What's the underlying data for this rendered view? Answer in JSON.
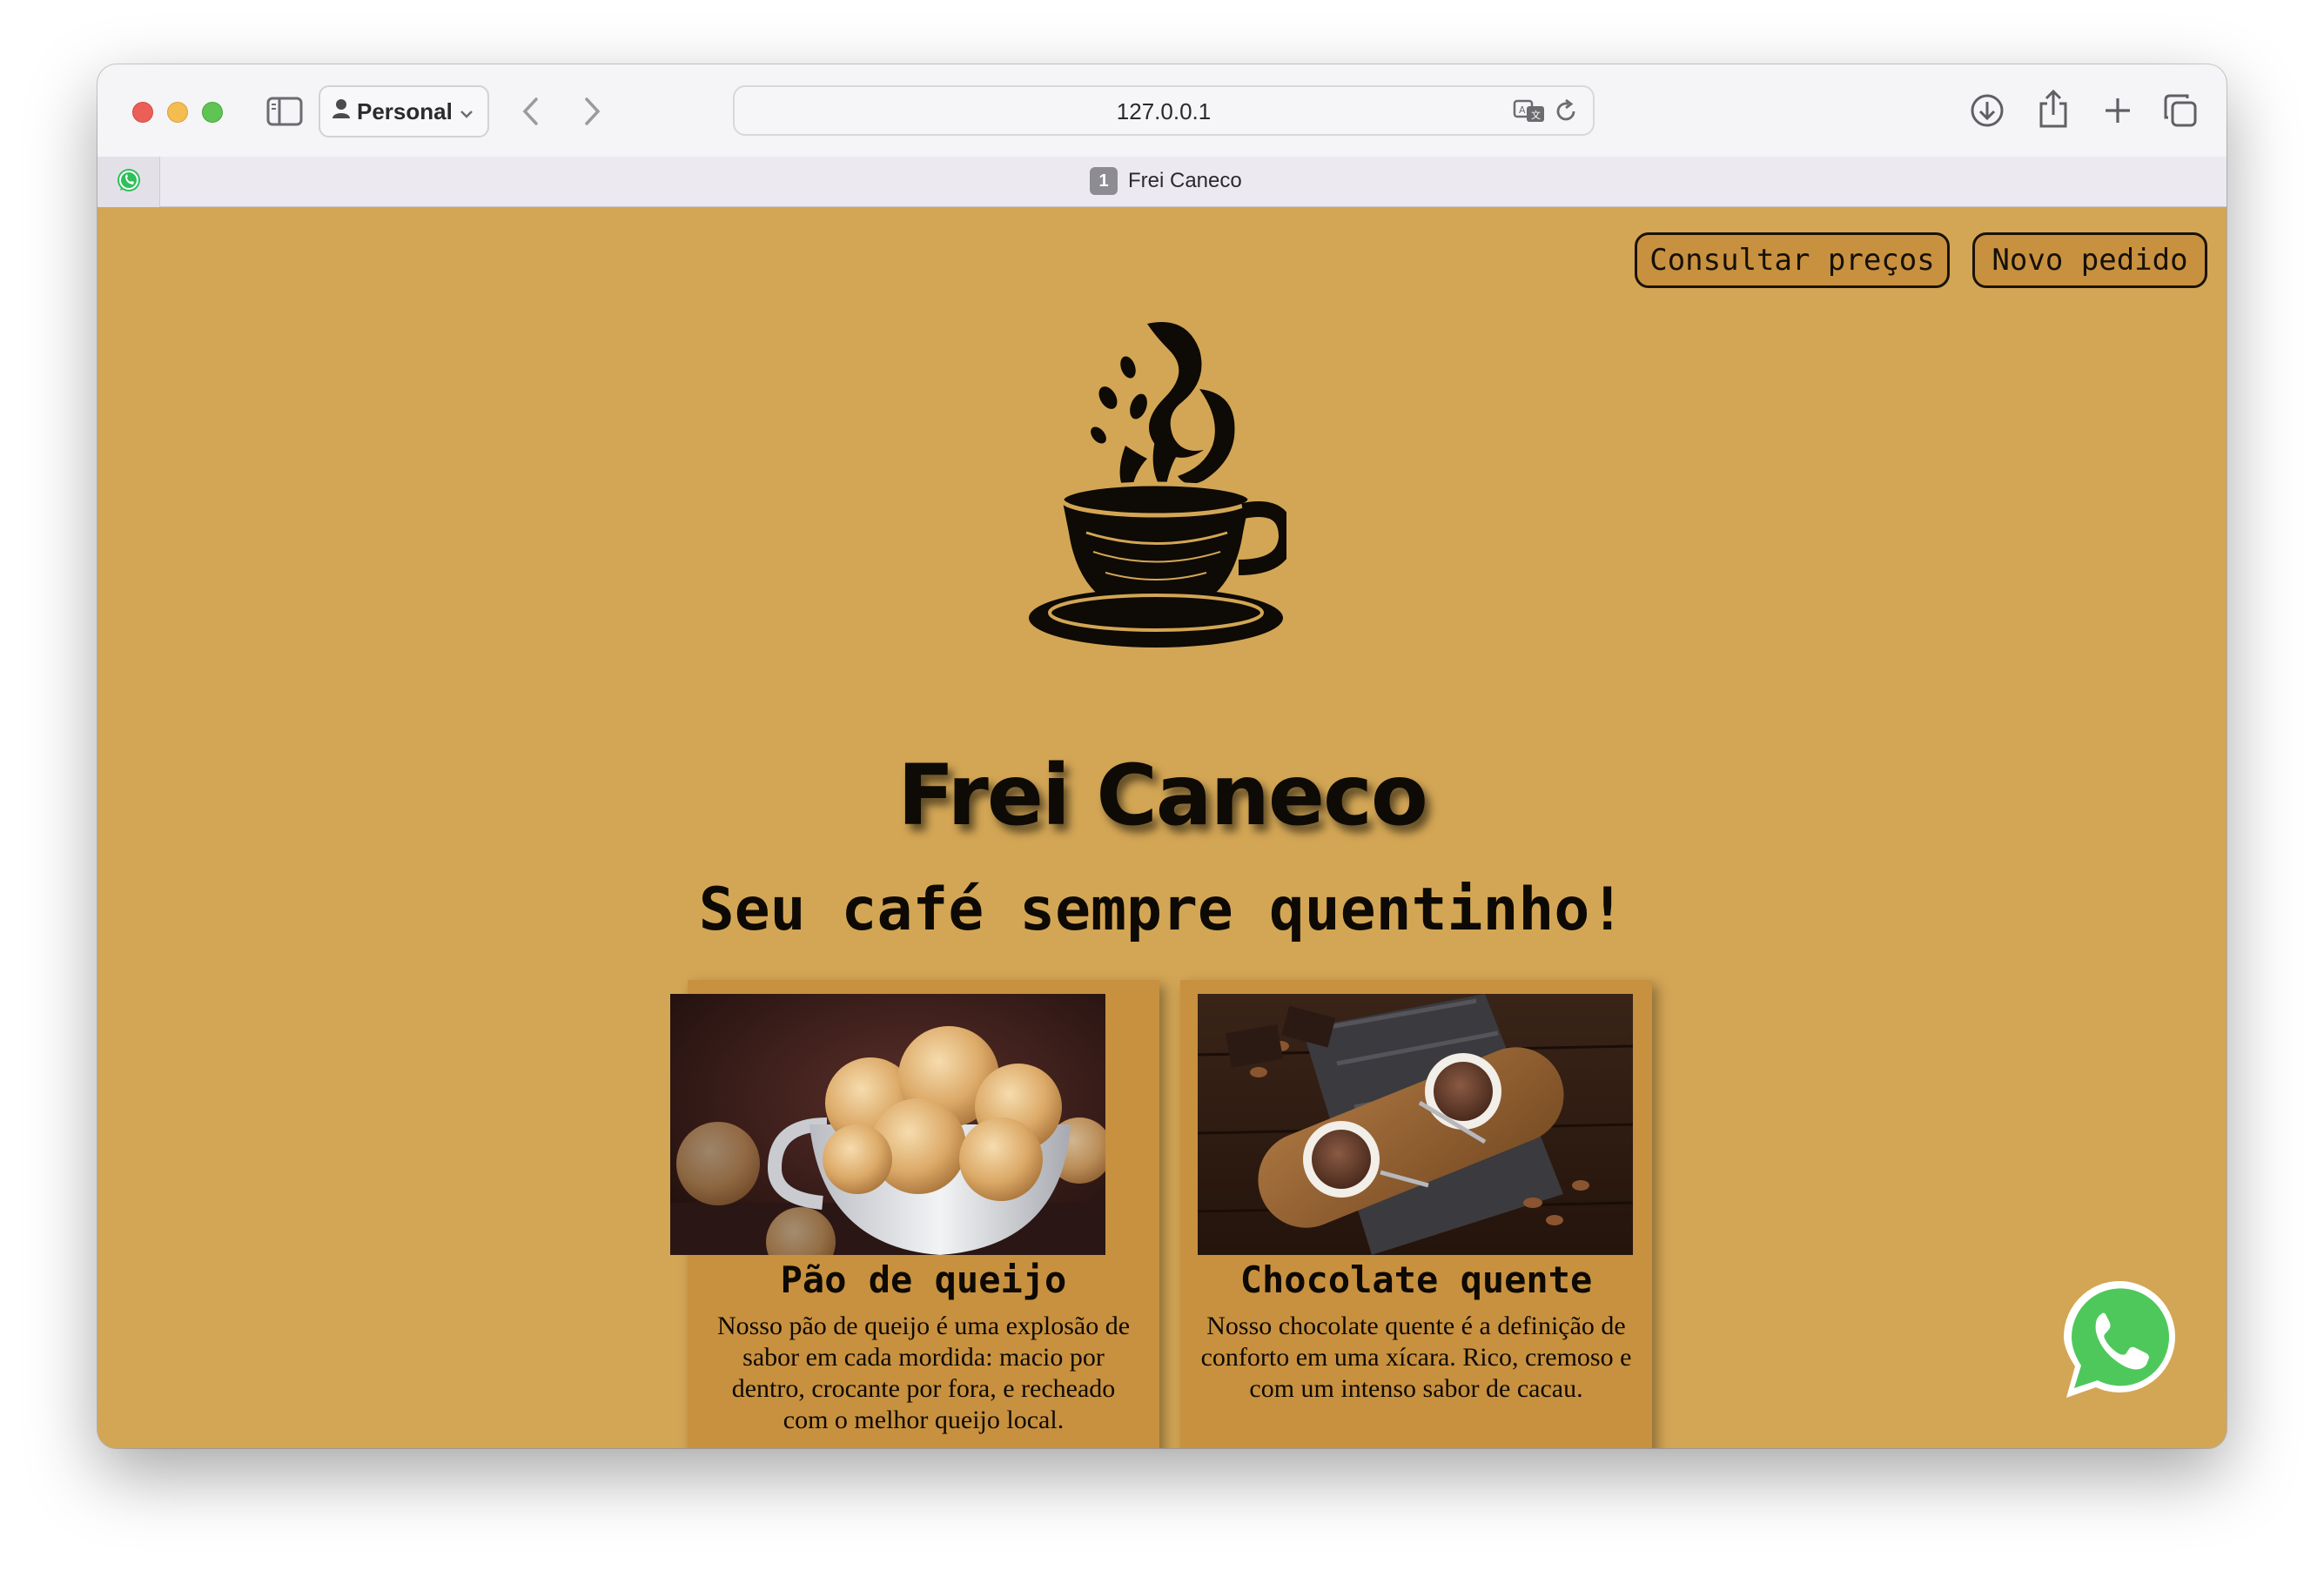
{
  "browser": {
    "profile_label": "Personal",
    "address": "127.0.0.1",
    "tab_number": "1",
    "tab_title": "Frei Caneco"
  },
  "header": {
    "prices_button": "Consultar preços",
    "order_button": "Novo pedido"
  },
  "hero": {
    "brand": "Frei Caneco",
    "tagline": "Seu café sempre quentinho!"
  },
  "products": [
    {
      "title": "Pão de queijo",
      "description": "Nosso pão de queijo é uma explosão de sabor em cada mordida: macio por dentro, crocante por fora, e recheado com o melhor queijo local."
    },
    {
      "title": "Chocolate quente",
      "description": "Nosso chocolate quente é a definição de conforto em uma xícara. Rico, cremoso e com um intenso sabor de cacau."
    }
  ],
  "colors": {
    "page_background": "#d3a655",
    "card_background": "#c8913f",
    "whatsapp_green": "#4fc85b"
  },
  "icons": [
    "sidebar-icon",
    "person-icon",
    "chevron-down-icon",
    "back-icon",
    "forward-icon",
    "translate-icon",
    "reload-icon",
    "download-icon",
    "share-icon",
    "new-tab-icon",
    "tab-overview-icon",
    "whatsapp-icon",
    "coffee-cup-logo"
  ]
}
